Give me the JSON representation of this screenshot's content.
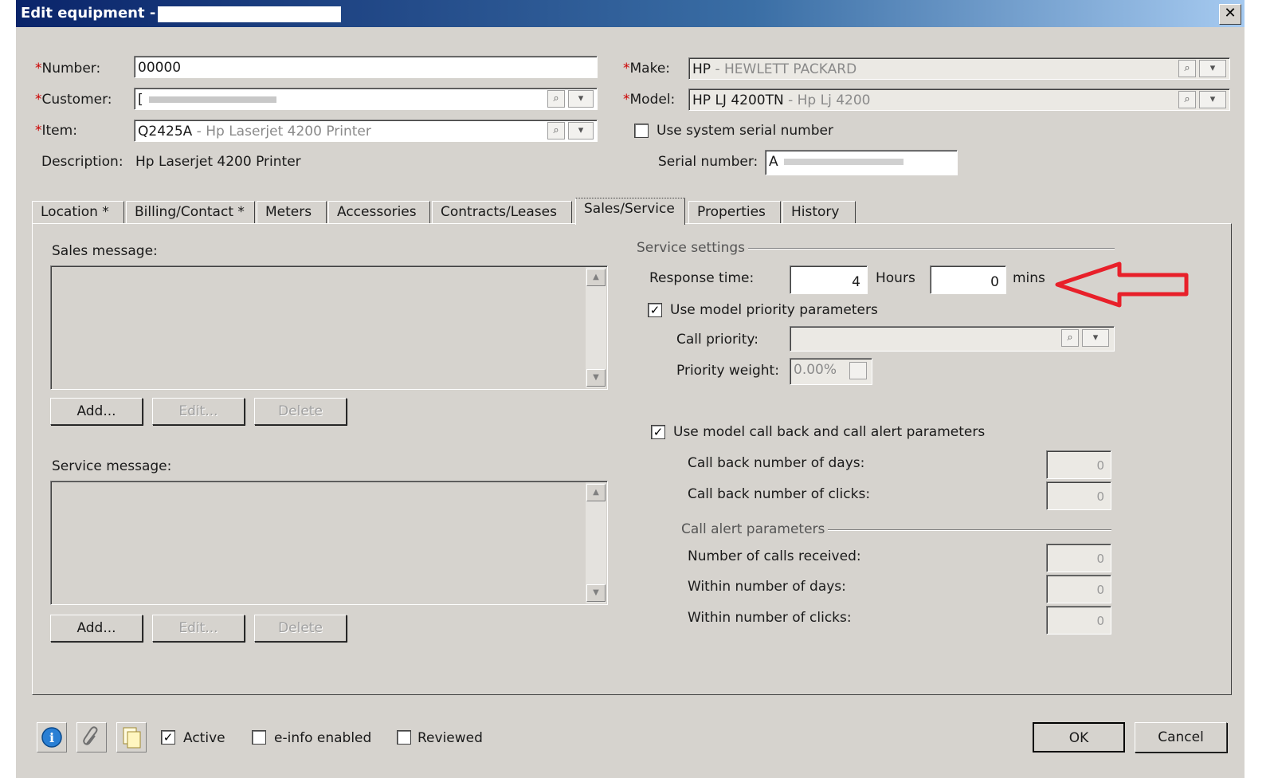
{
  "window": {
    "title": "Edit equipment - [",
    "close_glyph": "✕"
  },
  "fields": {
    "number": {
      "label": "Number:",
      "value": "00000"
    },
    "customer": {
      "label": "Customer:",
      "value": "["
    },
    "item": {
      "label": "Item:",
      "code": "Q2425A",
      "desc": " - Hp Laserjet 4200 Printer"
    },
    "description": {
      "label": "Description:",
      "value": "Hp Laserjet 4200 Printer"
    },
    "make": {
      "label": "Make:",
      "code": "HP",
      "desc": " - HEWLETT PACKARD"
    },
    "model": {
      "label": "Model:",
      "code": "HP LJ 4200TN",
      "desc": " - Hp Lj 4200"
    },
    "use_system_serial": {
      "label": "Use system serial number",
      "checked": false,
      "mark": ""
    },
    "serial": {
      "label": "Serial number:",
      "value": "A"
    },
    "required_mark": "*"
  },
  "tabs": [
    {
      "label": "Location *"
    },
    {
      "label": "Billing/Contact *"
    },
    {
      "label": "Meters"
    },
    {
      "label": "Accessories"
    },
    {
      "label": "Contracts/Leases"
    },
    {
      "label": "Sales/Service",
      "active": true
    },
    {
      "label": "Properties"
    },
    {
      "label": "History"
    }
  ],
  "sales_message": {
    "label": "Sales message:",
    "add": "Add...",
    "edit": "Edit...",
    "delete": "Delete"
  },
  "service_message": {
    "label": "Service message:",
    "add": "Add...",
    "edit": "Edit...",
    "delete": "Delete"
  },
  "service_settings": {
    "caption": "Service settings",
    "response_time": {
      "label": "Response time:",
      "hours": "4",
      "hours_unit": "Hours",
      "mins": "0",
      "mins_unit": "mins"
    },
    "use_model_priority": {
      "label": "Use model priority parameters",
      "checked": true,
      "mark": "✓"
    },
    "call_priority": {
      "label": "Call priority:",
      "value": ""
    },
    "priority_weight": {
      "label": "Priority weight:",
      "value": "0.00%"
    },
    "use_model_callback": {
      "label": "Use model call back and call alert parameters",
      "checked": true,
      "mark": "✓"
    },
    "call_back_days": {
      "label": "Call back number of days:",
      "value": "0"
    },
    "call_back_clicks": {
      "label": "Call back number of clicks:",
      "value": "0"
    },
    "call_alert": {
      "caption": "Call alert parameters",
      "calls_received": {
        "label": "Number of calls received:",
        "value": "0"
      },
      "within_days": {
        "label": "Within number of days:",
        "value": "0"
      },
      "within_clicks": {
        "label": "Within number of clicks:",
        "value": "0"
      }
    }
  },
  "footer": {
    "active": {
      "label": "Active",
      "checked": true,
      "mark": "✓"
    },
    "einfo": {
      "label": "e-info enabled",
      "checked": false,
      "mark": ""
    },
    "reviewed": {
      "label": "Reviewed",
      "checked": false,
      "mark": ""
    },
    "ok": "OK",
    "cancel": "Cancel"
  },
  "annotation": {
    "arrow_color": "#e8202a"
  },
  "icons": {
    "lookup": "⌕",
    "dropdown": "▾",
    "scroll_up": "▲",
    "scroll_down": "▼",
    "info": "i"
  }
}
